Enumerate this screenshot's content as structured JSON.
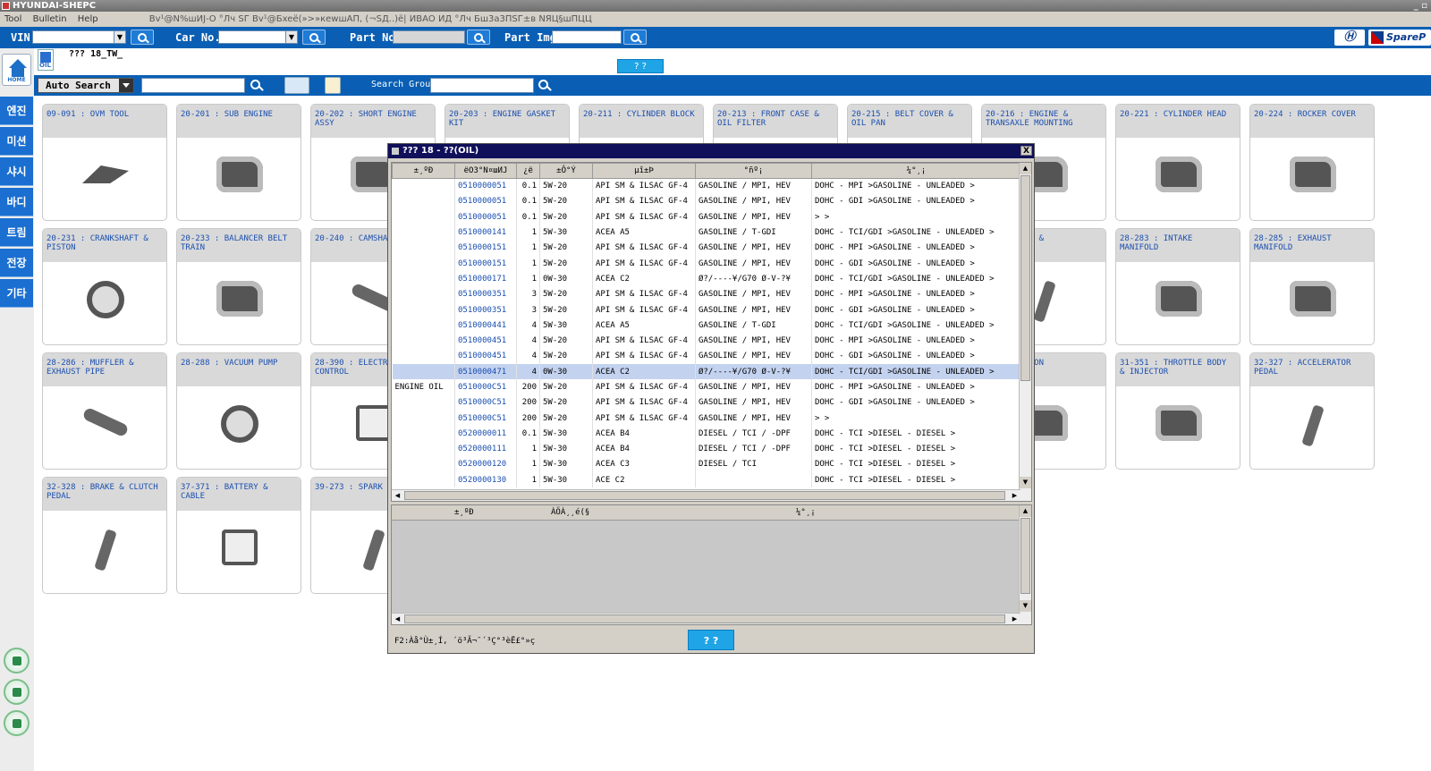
{
  "window": {
    "title": "HYUNDAI-SHEPC",
    "controls": "_ ▫"
  },
  "menu": {
    "items": [
      "Tool",
      "Bulletin",
      "Help"
    ],
    "status_text": "Bv¹@N%шИЈ-O °Лч SГ Bv¹@Бxeё(»>»кеwшАП, (¬SД..)ё| ИВАО ИД °Лч Бш3а3ПSГ±в NЯЦ§шПЦЦ"
  },
  "search": {
    "vin_label": "VIN",
    "carno_label": "Car No.",
    "partno_label": "Part No.",
    "partimg_label": "Part Img.",
    "logo_h": "Ⓗ",
    "logo_spare": "SpareP"
  },
  "page": {
    "car_title": "??? 18_TW_",
    "top_button": "? ?",
    "oil_icon_label": "OIL",
    "home_label": "HOME"
  },
  "sidebar": {
    "items": [
      "엔진",
      "미션",
      "샤시",
      "바디",
      "트림",
      "전장",
      "기타"
    ]
  },
  "toolbar": {
    "auto_search": "Auto Search",
    "search_group_label": "Search Group"
  },
  "tiles": [
    "09-091 : OVM TOOL",
    "20-201 : SUB ENGINE",
    "20-202 : SHORT ENGINE ASSY",
    "20-203 : ENGINE GASKET KIT",
    "20-211 : CYLINDER BLOCK",
    "20-213 : FRONT CASE & OIL FILTER",
    "20-215 : BELT COVER & OIL PAN",
    "20-216 : ENGINE & TRANSAXLE MOUNTING",
    "20-221 : CYLINDER HEAD",
    "20-224 : ROCKER COVER",
    "20-231 : CRANKSHAFT & PISTON",
    "20-233 : BALANCER BELT TRAIN",
    "20-240 : CAMSHAF",
    "",
    "",
    "",
    "",
    "RBOCHARGER &",
    "28-283 : INTAKE MANIFOLD",
    "28-285 : EXHAUST MANIFOLD",
    "28-286 : MUFFLER & EXHAUST PIPE",
    "28-288 : VACUUM PUMP",
    "28-390 : ELECTRO CONTROL",
    "",
    "",
    "",
    "",
    "EL INJECTION",
    "31-351 : THROTTLE BODY & INJECTOR",
    "32-327 : ACCELERATOR PEDAL",
    "32-328 : BRAKE & CLUTCH PEDAL",
    "37-371 : BATTERY & CABLE",
    "39-273 : SPARK P CABLE"
  ],
  "dialog": {
    "title": "??? 18 - ??(OIL)",
    "close": "X",
    "columns": [
      "±¸ºÐ",
      "ёО3°N¤шИЈ",
      "¿ё",
      "±Ô°Ý",
      "µî±Þ",
      "°ñº¡",
      "¼°¸¡"
    ],
    "rows": [
      {
        "cat": "",
        "pn": "0510000051",
        "qty": "0.1",
        "visc": "5W-20",
        "grade": "API SM & ILSAC GF-4",
        "fuel": "GASOLINE / MPI, HEV",
        "spec": "DOHC - MPI >GASOLINE - UNLEADED >"
      },
      {
        "cat": "",
        "pn": "0510000051",
        "qty": "0.1",
        "visc": "5W-20",
        "grade": "API SM & ILSAC GF-4",
        "fuel": "GASOLINE / MPI, HEV",
        "spec": "DOHC - GDI >GASOLINE - UNLEADED >"
      },
      {
        "cat": "",
        "pn": "0510000051",
        "qty": "0.1",
        "visc": "5W-20",
        "grade": "API SM & ILSAC GF-4",
        "fuel": "GASOLINE / MPI, HEV",
        "spec": " > >"
      },
      {
        "cat": "",
        "pn": "0510000141",
        "qty": "1",
        "visc": "5W-30",
        "grade": "ACEA A5",
        "fuel": "GASOLINE / T-GDI",
        "spec": "DOHC - TCI/GDI >GASOLINE - UNLEADED >"
      },
      {
        "cat": "",
        "pn": "0510000151",
        "qty": "1",
        "visc": "5W-20",
        "grade": "API SM & ILSAC GF-4",
        "fuel": "GASOLINE / MPI, HEV",
        "spec": "DOHC - MPI >GASOLINE - UNLEADED >"
      },
      {
        "cat": "",
        "pn": "0510000151",
        "qty": "1",
        "visc": "5W-20",
        "grade": "API SM & ILSAC GF-4",
        "fuel": "GASOLINE / MPI, HEV",
        "spec": "DOHC - GDI >GASOLINE - UNLEADED >"
      },
      {
        "cat": "",
        "pn": "0510000171",
        "qty": "1",
        "visc": "0W-30",
        "grade": "ACEA C2",
        "fuel": "Ø?/----¥/G70 Ø-V-?¥",
        "spec": "DOHC - TCI/GDI >GASOLINE - UNLEADED >"
      },
      {
        "cat": "",
        "pn": "0510000351",
        "qty": "3",
        "visc": "5W-20",
        "grade": "API SM & ILSAC GF-4",
        "fuel": "GASOLINE / MPI, HEV",
        "spec": "DOHC - MPI >GASOLINE - UNLEADED >"
      },
      {
        "cat": "",
        "pn": "0510000351",
        "qty": "3",
        "visc": "5W-20",
        "grade": "API SM & ILSAC GF-4",
        "fuel": "GASOLINE / MPI, HEV",
        "spec": "DOHC - GDI >GASOLINE - UNLEADED >"
      },
      {
        "cat": "",
        "pn": "0510000441",
        "qty": "4",
        "visc": "5W-30",
        "grade": "ACEA A5",
        "fuel": "GASOLINE / T-GDI",
        "spec": "DOHC - TCI/GDI >GASOLINE - UNLEADED >"
      },
      {
        "cat": "",
        "pn": "0510000451",
        "qty": "4",
        "visc": "5W-20",
        "grade": "API SM & ILSAC GF-4",
        "fuel": "GASOLINE / MPI, HEV",
        "spec": "DOHC - MPI >GASOLINE - UNLEADED >"
      },
      {
        "cat": "",
        "pn": "0510000451",
        "qty": "4",
        "visc": "5W-20",
        "grade": "API SM & ILSAC GF-4",
        "fuel": "GASOLINE / MPI, HEV",
        "spec": "DOHC - GDI >GASOLINE - UNLEADED >"
      },
      {
        "cat": "",
        "pn": "0510000471",
        "qty": "4",
        "visc": "0W-30",
        "grade": "ACEA C2",
        "fuel": "Ø?/----¥/G70 Ø-V-?¥",
        "spec": "DOHC - TCI/GDI >GASOLINE - UNLEADED >",
        "selected": true
      },
      {
        "cat": "ENGINE OIL",
        "pn": "0510000C51",
        "qty": "200",
        "visc": "5W-20",
        "grade": "API SM & ILSAC GF-4",
        "fuel": "GASOLINE / MPI, HEV",
        "spec": "DOHC - MPI >GASOLINE - UNLEADED >"
      },
      {
        "cat": "",
        "pn": "0510000C51",
        "qty": "200",
        "visc": "5W-20",
        "grade": "API SM & ILSAC GF-4",
        "fuel": "GASOLINE / MPI, HEV",
        "spec": "DOHC - GDI >GASOLINE - UNLEADED >"
      },
      {
        "cat": "",
        "pn": "0510000C51",
        "qty": "200",
        "visc": "5W-20",
        "grade": "API SM & ILSAC GF-4",
        "fuel": "GASOLINE / MPI, HEV",
        "spec": " > >"
      },
      {
        "cat": "",
        "pn": "0520000011",
        "qty": "0.1",
        "visc": "5W-30",
        "grade": "ACEA B4",
        "fuel": "DIESEL / TCI / -DPF",
        "spec": "DOHC - TCI >DIESEL - DIESEL >"
      },
      {
        "cat": "",
        "pn": "0520000111",
        "qty": "1",
        "visc": "5W-30",
        "grade": "ACEA B4",
        "fuel": "DIESEL / TCI / -DPF",
        "spec": "DOHC - TCI >DIESEL - DIESEL >"
      },
      {
        "cat": "",
        "pn": "0520000120",
        "qty": "1",
        "visc": "5W-30",
        "grade": "ACEA C3",
        "fuel": "DIESEL / TCI",
        "spec": "DOHC - TCI >DIESEL - DIESEL >"
      },
      {
        "cat": "",
        "pn": "0520000130",
        "qty": "1",
        "visc": "5W-30",
        "grade": "ACE C2",
        "fuel": "",
        "spec": "DOHC - TCI >DIESEL - DIESEL >"
      }
    ],
    "lower_columns": [
      "±¸ºÐ",
      "ÀÖÀ¸¸é(§",
      "¼°¸¡"
    ],
    "status": "F2:Àå°Ù±¸Í, ´ö³Ã¬¯´³Ç°³èË£°»ç",
    "button": "? ?"
  }
}
